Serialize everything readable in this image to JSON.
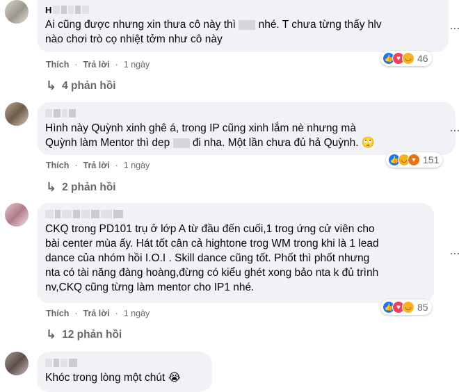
{
  "comments": [
    {
      "text": "Ai cũng được nhưng xin thưa cô này thì ___ nhé. T chưa từng thấy hlv\nnào chơi trò cọ nhiệt tởm như cô này",
      "text_a": "Ai cũng được nhưng xin thưa cô này thì ",
      "text_b": " nhé. T chưa từng thấy hlv\nnào chơi trò cọ nhiệt tởm như cô này",
      "reaction_icons": [
        "like-icon",
        "love-icon",
        "haha-icon"
      ],
      "reaction_count": "46",
      "like": "Thích",
      "reply": "Trả lời",
      "time": "1 ngày",
      "replies": "4 phản hồi"
    },
    {
      "text_a": "Hình này Quỳnh xinh ghê á, trong IP cũng xinh lắm nè nhưng mà\nQuỳnh làm Mentor thì dep ",
      "text_b": " đi nha. Một lần chưa đủ hả Quỳnh. 🙄",
      "reaction_icons": [
        "like-icon",
        "haha-icon",
        "angry-icon"
      ],
      "reaction_count": "151",
      "like": "Thích",
      "reply": "Trả lời",
      "time": "1 ngày",
      "replies": "2 phản hồi"
    },
    {
      "text": "CKQ trong PD101 trụ ở lớp A từ đầu đến cuối,1 trog ứng cử viên cho\nbài center mùa ấy. Hát tốt cân cả hightone trog WM trong khi là 1 lead\ndance của nhóm hồi I.O.I . Skill dance cũng tốt. Phốt thì phốt nhưng\nnta có tài năng đàng hoàng,đừng có kiểu ghét xong bảo nta k đủ trình\nnv,CKQ cũng từng làm mentor cho IP1 nhé.",
      "reaction_icons": [
        "like-icon",
        "love-icon",
        "haha-icon"
      ],
      "reaction_count": "85",
      "like": "Thích",
      "reply": "Trả lời",
      "time": "1 ngày",
      "replies": "12 phản hồi"
    },
    {
      "text": "Khóc trong lòng một chút 😭"
    }
  ],
  "colors": {
    "bubble": "#f0f2f5",
    "meta_text": "#65676b",
    "like_blue": "#1877f2",
    "love_red": "#f33e58",
    "haha_yellow": "#f7b125"
  }
}
